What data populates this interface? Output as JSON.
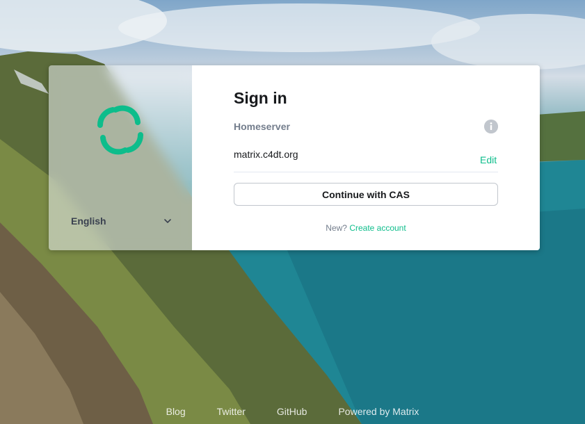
{
  "language": {
    "selected": "English"
  },
  "signin": {
    "title": "Sign in",
    "homeserver_label": "Homeserver",
    "homeserver_value": "matrix.c4dt.org",
    "edit_label": "Edit",
    "cas_button_label": "Continue with CAS",
    "new_prompt": "New?",
    "create_account_label": "Create account"
  },
  "footer": {
    "links": [
      "Blog",
      "Twitter",
      "GitHub",
      "Powered by Matrix"
    ]
  },
  "colors": {
    "accent": "#0dbd8b",
    "title_text": "#17191c",
    "secondary_text": "#737d8c"
  },
  "icons": {
    "logo": "element-logo",
    "info": "info-icon",
    "language_chevron": "chevron-down-icon"
  }
}
